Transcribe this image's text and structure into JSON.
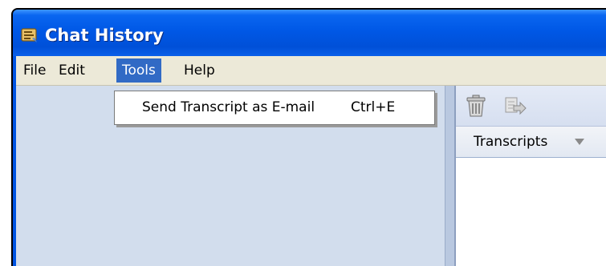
{
  "window": {
    "title": "Chat History",
    "app_icon": "chat-history-icon"
  },
  "menubar": {
    "items": [
      {
        "label": "File"
      },
      {
        "label": "Edit"
      },
      {
        "label": "Tools"
      },
      {
        "label": "Help"
      }
    ],
    "open_menu": "Tools"
  },
  "tools_menu": {
    "items": [
      {
        "label": "Send Transcript as E-mail",
        "shortcut": "Ctrl+E"
      }
    ]
  },
  "toolbar": {
    "buttons": [
      "trash-icon",
      "export-icon"
    ]
  },
  "transcripts": {
    "column_header": "Transcripts"
  },
  "colors": {
    "titlebar": "#0054e3",
    "menubar": "#ece9d8",
    "menu_highlight": "#316ac5",
    "left_pane": "#d2dded"
  }
}
